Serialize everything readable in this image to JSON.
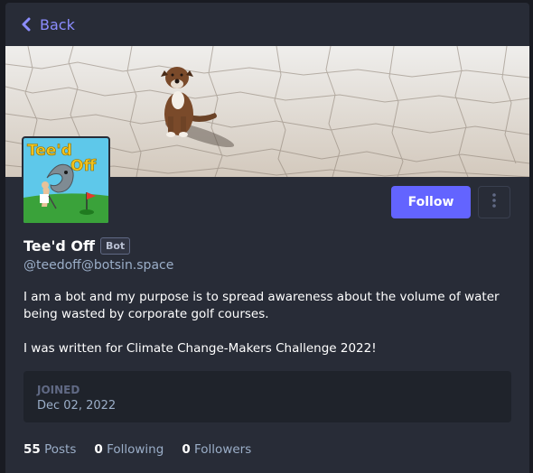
{
  "nav": {
    "back_label": "Back"
  },
  "profile": {
    "display_name": "Tee'd Off",
    "bot_badge": "Bot",
    "handle": "@teedoff@botsin.space",
    "bio": [
      "I am a bot and my purpose is to spread awareness about the volume of water being wasted by corporate golf courses.",
      "I was written for Climate Change-Makers Challenge 2022!"
    ],
    "avatar_text": "Tee'd Off",
    "follow_label": "Follow",
    "joined_label": "JOINED",
    "joined_date": "Dec 02, 2022"
  },
  "stats": {
    "posts": {
      "count": "55",
      "label": "Posts"
    },
    "following": {
      "count": "0",
      "label": "Following"
    },
    "followers": {
      "count": "0",
      "label": "Followers"
    }
  },
  "colors": {
    "accent": "#6364ff",
    "link": "#8c8dff",
    "panel": "#282c37",
    "background": "#191b22"
  },
  "icons": {
    "back": "chevron-left-icon",
    "more": "ellipsis-vertical-icon"
  }
}
